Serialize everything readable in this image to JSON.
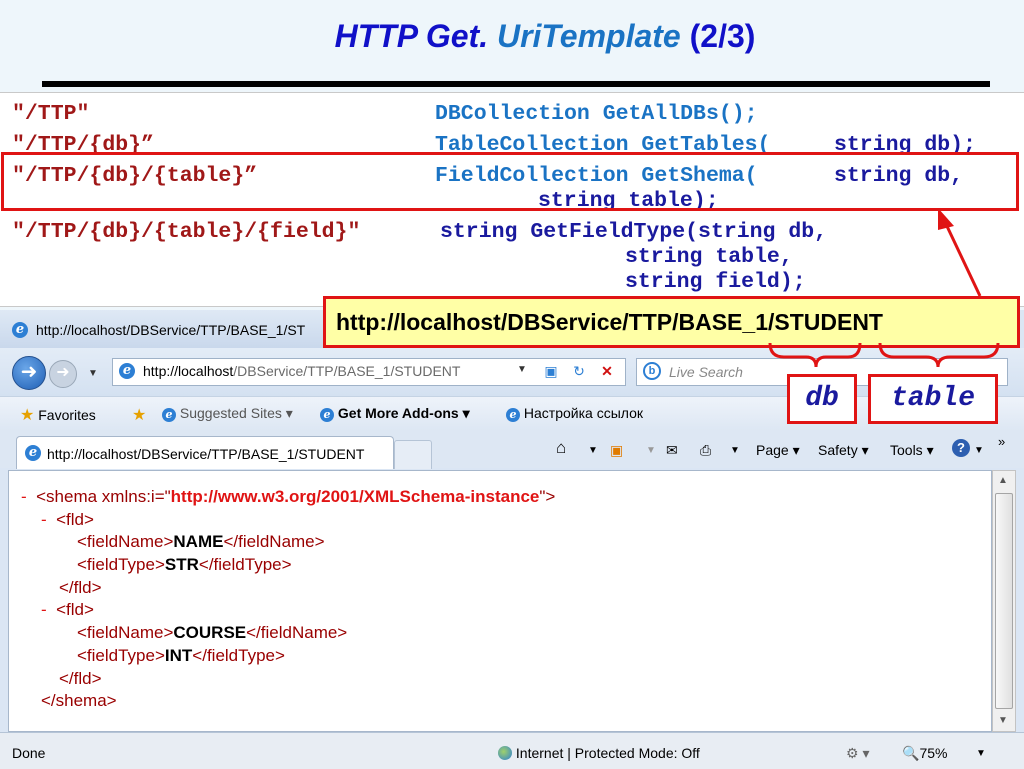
{
  "slide": {
    "title_part1": "HTTP Get.",
    "title_part2": "UriTemplate",
    "title_part3": "(2/3)"
  },
  "code_rows": [
    {
      "route": "\"/TTP\"",
      "signature": "DBCollection GetAllDBs();"
    },
    {
      "route": "\"/TTP/{db}”",
      "signature_prefix": "TableCollection GetTables(",
      "signature_args": "string db);"
    },
    {
      "route": "\"/TTP/{db}/{table}”",
      "signature_prefix": "FieldCollection GetShema(",
      "signature_args": "string db,",
      "signature_cont": "string table);"
    },
    {
      "route": "\"/TTP/{db}/{table}/{field}\"",
      "signature": "string GetFieldType(string db,",
      "signature_cont1": "string table,",
      "signature_cont2": "string field);"
    }
  ],
  "callout": {
    "url": "http://localhost/DBService/TTP/BASE_1/STUDENT",
    "db_label": "db",
    "table_label": "table"
  },
  "browser": {
    "window_title": "http://localhost/DBService/TTP/BASE_1/ST",
    "address_host": "http://localhost",
    "address_path": "/DBService/TTP/BASE_1/STUDENT",
    "search_placeholder": "Live Search",
    "favorites_label": "Favorites",
    "suggested_sites": "Suggested Sites ▾",
    "get_addons": "Get More Add-ons ▾",
    "link_settings": "Настройка ссылок",
    "tab_title": "http://localhost/DBService/TTP/BASE_1/STUDENT",
    "cmd_page": "Page ▾",
    "cmd_safety": "Safety ▾",
    "cmd_tools": "Tools ▾",
    "status_done": "Done",
    "status_zone": "Internet | Protected Mode: Off",
    "status_zoom": "75%"
  },
  "xml": {
    "root_open_tag": "<shema xmlns:i=\"",
    "root_ns": "http://www.w3.org/2001/XMLSchema-instance",
    "root_close_bracket": "\">",
    "fld_open": "<fld>",
    "fld_close": "</fld>",
    "fieldname_open": "<fieldName>",
    "fieldname_close": "</fieldName>",
    "fieldtype_open": "<fieldType>",
    "fieldtype_close": "</fieldType>",
    "root_close": "</shema>",
    "fields": [
      {
        "name": "NAME",
        "type": "STR"
      },
      {
        "name": "COURSE",
        "type": "INT"
      }
    ],
    "collapse_marker": "-"
  },
  "colors": {
    "accent_red": "#e01414",
    "title_blue": "#1010c8",
    "callout_bg": "#ffffa6"
  }
}
